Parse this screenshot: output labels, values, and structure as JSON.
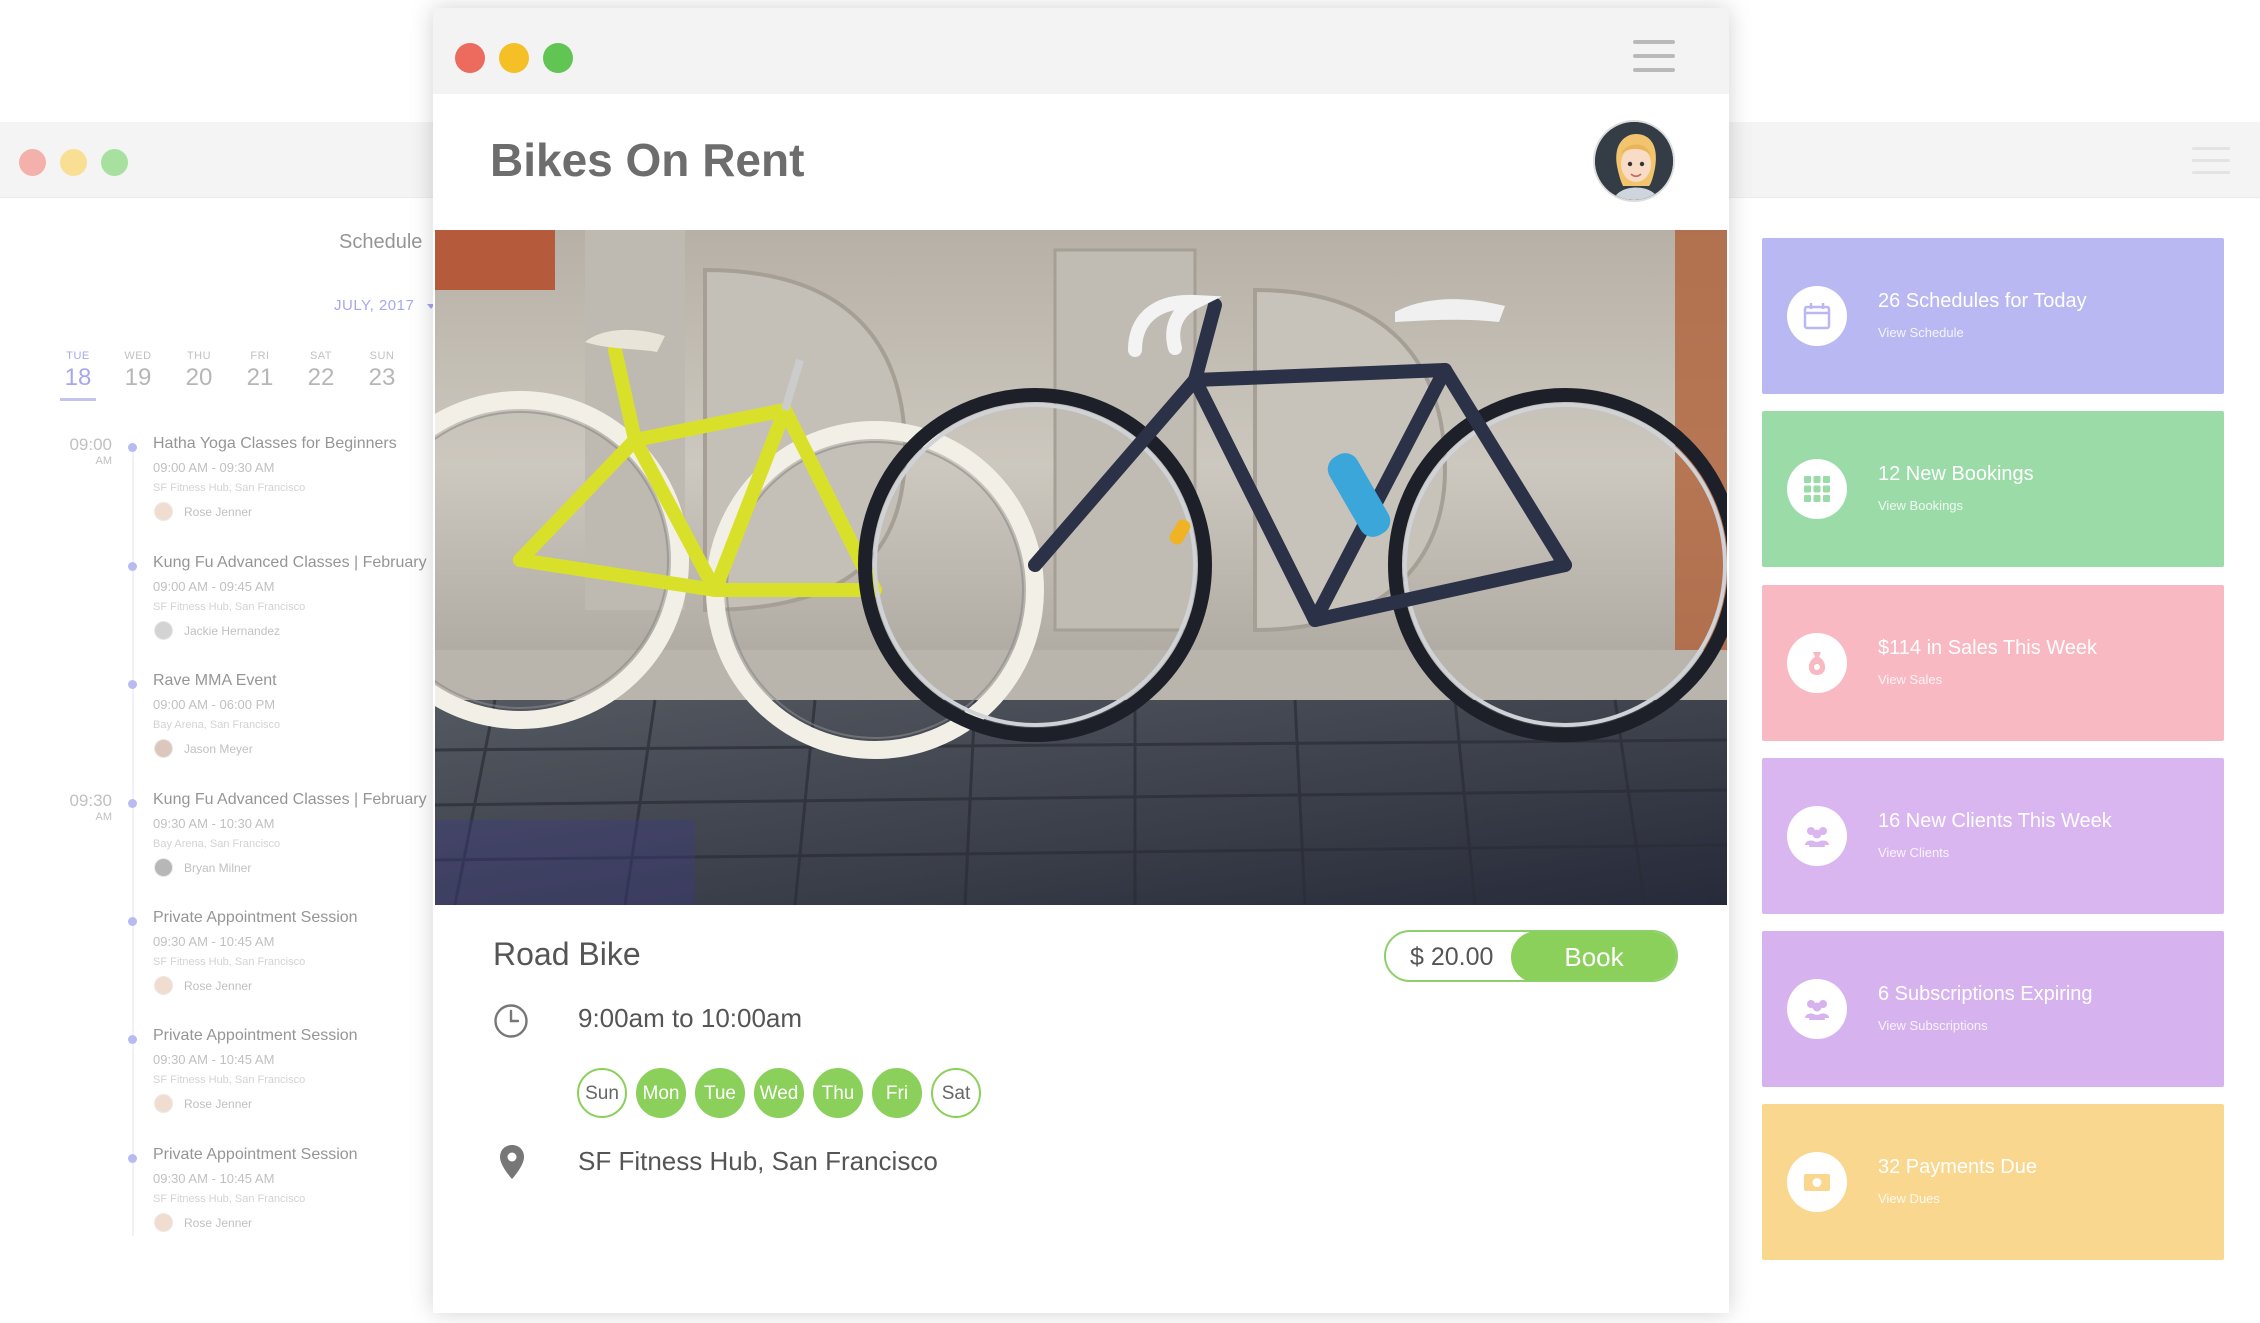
{
  "background": {
    "schedule": {
      "title": "Schedule",
      "month": "JULY, 2017",
      "days": [
        {
          "name": "TUE",
          "num": "18"
        },
        {
          "name": "WED",
          "num": "19"
        },
        {
          "name": "THU",
          "num": "20"
        },
        {
          "name": "FRI",
          "num": "21"
        },
        {
          "name": "SAT",
          "num": "22"
        },
        {
          "name": "SUN",
          "num": "23"
        }
      ],
      "time_labels": [
        {
          "time": "09:00",
          "ampm": "AM"
        },
        {
          "time": "09:30",
          "ampm": "AM"
        }
      ],
      "events": [
        {
          "title": "Hatha Yoga Classes for Beginners",
          "time": "09:00 AM - 09:30 AM",
          "location": "SF Fitness Hub, San Francisco",
          "person": "Rose Jenner"
        },
        {
          "title": "Kung Fu Advanced Classes | February",
          "time": "09:00 AM - 09:45 AM",
          "location": "SF Fitness Hub, San Francisco",
          "person": "Jackie Hernandez"
        },
        {
          "title": "Rave MMA Event",
          "time": "09:00 AM - 06:00 PM",
          "location": "Bay Arena, San Francisco",
          "person": "Jason Meyer"
        },
        {
          "title": "Kung Fu Advanced Classes | February",
          "time": "09:30 AM - 10:30 AM",
          "location": "Bay Arena, San Francisco",
          "person": "Bryan Milner"
        },
        {
          "title": "Private Appointment Session",
          "time": "09:30 AM - 10:45 AM",
          "location": "SF Fitness Hub, San Francisco",
          "person": "Rose Jenner"
        },
        {
          "title": "Private Appointment Session",
          "time": "09:30 AM - 10:45 AM",
          "location": "SF Fitness Hub, San Francisco",
          "person": "Rose Jenner"
        },
        {
          "title": "Private Appointment Session",
          "time": "09:30 AM - 10:45 AM",
          "location": "SF Fitness Hub, San Francisco",
          "person": "Rose Jenner"
        }
      ]
    },
    "stats": [
      {
        "title": "26 Schedules for Today",
        "link": "View Schedule",
        "color": "#b9b8f2",
        "icon": "calendar-icon"
      },
      {
        "title": "12 New Bookings",
        "link": "View Bookings",
        "color": "#9adba8",
        "icon": "grid-icon"
      },
      {
        "title": "$114 in Sales This Week",
        "link": "View Sales",
        "color": "#f8b9c2",
        "icon": "money-bag-icon"
      },
      {
        "title": "16 New Clients This Week",
        "link": "View Clients",
        "color": "#d9b6f0",
        "icon": "users-icon"
      },
      {
        "title": "6 Subscriptions Expiring",
        "link": "View Subscriptions",
        "color": "#d6b3ef",
        "icon": "users-icon"
      },
      {
        "title": "32 Payments Due",
        "link": "View Dues",
        "color": "#fad78f",
        "icon": "cash-icon"
      }
    ]
  },
  "window": {
    "title": "Bikes On Rent",
    "item": {
      "name": "Road Bike",
      "price": "$ 20.00",
      "book_label": "Book",
      "time_range": "9:00am to 10:00am",
      "days": [
        {
          "label": "Sun",
          "active": false
        },
        {
          "label": "Mon",
          "active": true
        },
        {
          "label": "Tue",
          "active": true
        },
        {
          "label": "Wed",
          "active": true
        },
        {
          "label": "Thu",
          "active": true
        },
        {
          "label": "Fri",
          "active": true
        },
        {
          "label": "Sat",
          "active": false
        }
      ],
      "location": "SF Fitness Hub, San Francisco"
    }
  },
  "colors": {
    "accent_green": "#8bd05a",
    "schedule_accent": "#6f74e0",
    "dot_red": "#ec6a5e",
    "dot_yellow": "#f4c025",
    "dot_green": "#61c554"
  }
}
